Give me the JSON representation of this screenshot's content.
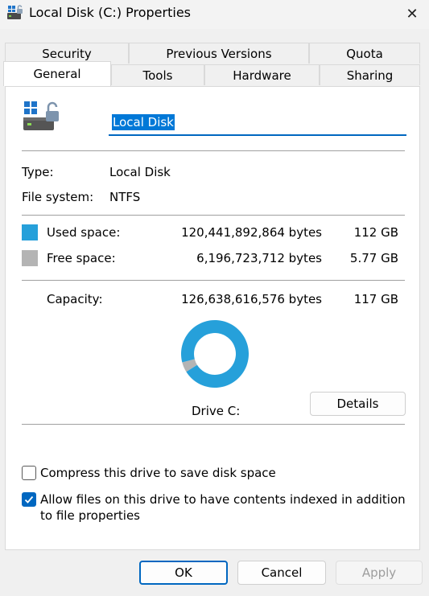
{
  "window": {
    "title": "Local Disk (C:) Properties",
    "close_glyph": "✕"
  },
  "tabs": {
    "row1": [
      {
        "label": "Security"
      },
      {
        "label": "Previous Versions"
      },
      {
        "label": "Quota"
      }
    ],
    "row2": [
      {
        "label": "General",
        "active": true
      },
      {
        "label": "Tools"
      },
      {
        "label": "Hardware"
      },
      {
        "label": "Sharing"
      }
    ]
  },
  "general": {
    "name_value": "Local Disk",
    "type_label": "Type:",
    "type_value": "Local Disk",
    "fs_label": "File system:",
    "fs_value": "NTFS",
    "used": {
      "label": "Used space:",
      "bytes": "120,441,892,864 bytes",
      "size": "112 GB",
      "color": "#26a0da"
    },
    "free": {
      "label": "Free space:",
      "bytes": "6,196,723,712 bytes",
      "size": "5.77 GB",
      "color": "#b4b4b4"
    },
    "capacity": {
      "label": "Capacity:",
      "bytes": "126,638,616,576 bytes",
      "size": "117 GB"
    },
    "used_fraction": 0.951,
    "drive_label": "Drive C:",
    "details_button": "Details",
    "compress": {
      "label": "Compress this drive to save disk space",
      "checked": false
    },
    "index": {
      "label": "Allow files on this drive to have contents indexed in addition to file properties",
      "checked": true
    }
  },
  "footer": {
    "ok": "OK",
    "cancel": "Cancel",
    "apply": "Apply"
  },
  "icons": {
    "title": "drive-icon",
    "close": "close-icon",
    "drive": "drive-icon",
    "check": "checkmark-icon"
  }
}
